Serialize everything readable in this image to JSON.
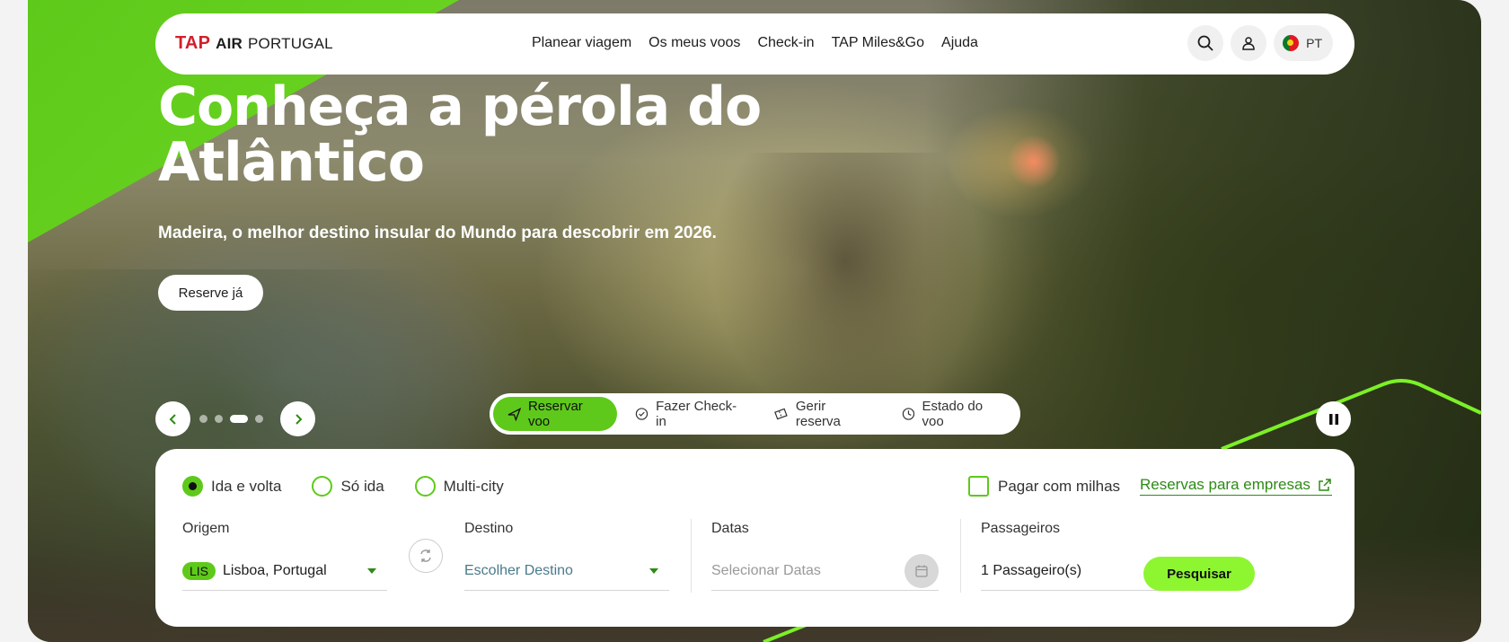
{
  "nav": {
    "logo_tap": "TAP",
    "logo_air": "AIR",
    "logo_portugal": "PORTUGAL",
    "links": [
      "Planear viagem",
      "Os meus voos",
      "Check-in",
      "TAP Miles&Go",
      "Ajuda"
    ],
    "language": "PT"
  },
  "hero": {
    "title": "Conheça a pérola do Atlântico",
    "subtitle": "Madeira, o melhor destino insular do Mundo para descobrir em 2026.",
    "cta": "Reserve já"
  },
  "carousel": {
    "slide_count": 4,
    "active_index": 2
  },
  "tabs": [
    {
      "label": "Reservar voo",
      "icon": "plane-icon",
      "active": true
    },
    {
      "label": "Fazer Check-in",
      "icon": "check-circle-icon",
      "active": false
    },
    {
      "label": "Gerir reserva",
      "icon": "ticket-icon",
      "active": false
    },
    {
      "label": "Estado do voo",
      "icon": "clock-icon",
      "active": false
    }
  ],
  "booking": {
    "trip_types": [
      "Ida e volta",
      "Só ida",
      "Multi-city"
    ],
    "selected_trip_type": "Ida e volta",
    "pay_with_miles": "Pagar com milhas",
    "business_link": "Reservas para empresas",
    "origin_label": "Origem",
    "origin_code": "LIS",
    "origin_value": "Lisboa, Portugal",
    "destination_label": "Destino",
    "destination_placeholder": "Escolher Destino",
    "dates_label": "Datas",
    "dates_placeholder": "Selecionar Datas",
    "passengers_label": "Passageiros",
    "passengers_value": "1 Passageiro(s)",
    "search_button": "Pesquisar"
  },
  "colors": {
    "brand_green": "#5ec91a",
    "search_green": "#8ef531",
    "link_green": "#2e8a16"
  }
}
